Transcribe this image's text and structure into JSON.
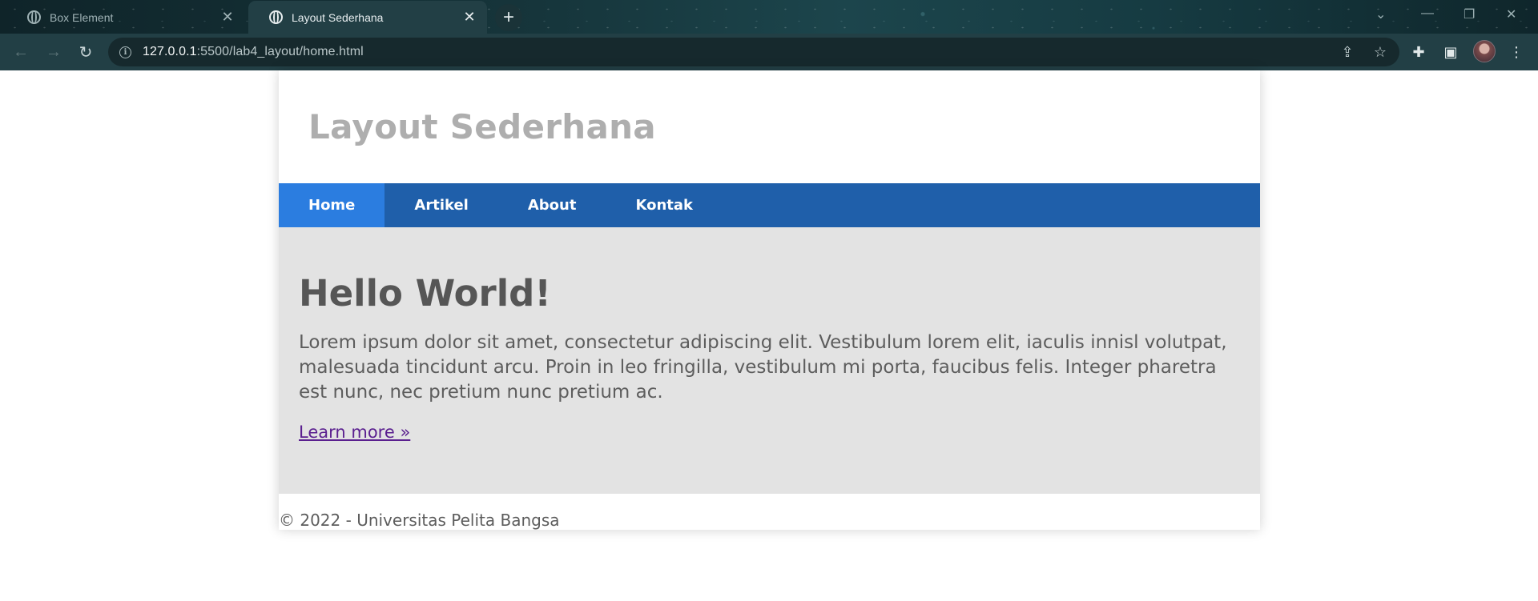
{
  "browser": {
    "tabs": [
      {
        "title": "Box Element",
        "active": false
      },
      {
        "title": "Layout Sederhana",
        "active": true
      }
    ],
    "new_tab_symbol": "+",
    "address": {
      "host": "127.0.0.1",
      "rest": ":5500/lab4_layout/home.html"
    },
    "icons": {
      "back": "back-arrow-icon",
      "forward": "forward-arrow-icon",
      "reload": "reload-icon",
      "info": "site-info-icon",
      "share": "share-icon",
      "bookmark": "star-icon",
      "extensions": "puzzle-icon",
      "sidepanel": "side-panel-icon",
      "menu": "kebab-menu-icon"
    }
  },
  "site": {
    "title": "Layout Sederhana",
    "nav": [
      {
        "label": "Home",
        "active": true
      },
      {
        "label": "Artikel",
        "active": false
      },
      {
        "label": "About",
        "active": false
      },
      {
        "label": "Kontak",
        "active": false
      }
    ],
    "hero": {
      "heading": "Hello World!",
      "body": "Lorem ipsum dolor sit amet, consectetur adipiscing elit. Vestibulum lorem elit, iaculis innisl volutpat, malesuada tincidunt arcu. Proin in leo fringilla, vestibulum mi porta, faucibus felis. Integer pharetra est nunc, nec pretium nunc pretium ac.",
      "link": "Learn more »"
    },
    "footer": "© 2022 - Universitas Pelita Bangsa"
  },
  "colors": {
    "nav_bg": "#1f5faa",
    "nav_active": "#2b7de0",
    "hero_bg": "#e3e3e3",
    "title": "#aeaeae",
    "link_visited": "#5a1f8f"
  }
}
